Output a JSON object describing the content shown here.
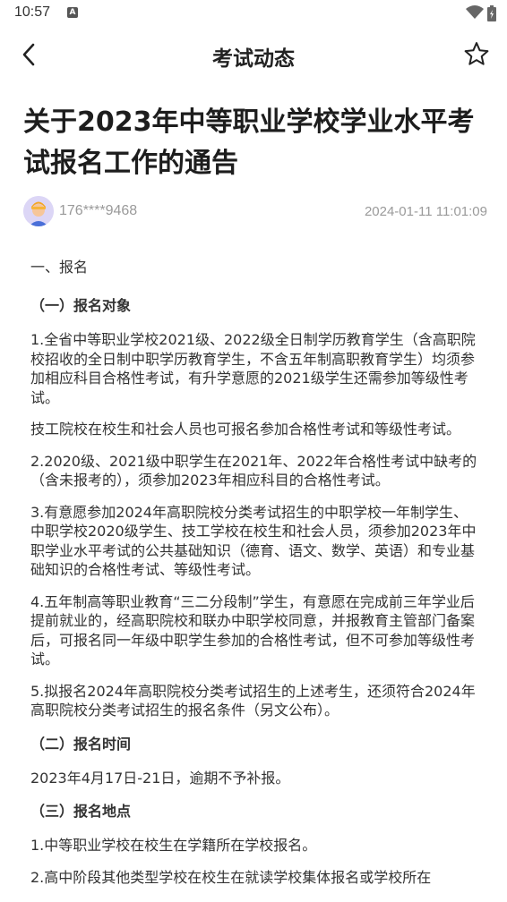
{
  "status_bar": {
    "time": "10:57",
    "a_label": "A"
  },
  "nav": {
    "title": "考试动态"
  },
  "article": {
    "title": "关于2023年中等职业学校学业水平考试报名工作的通告",
    "author": "176****9468",
    "date": "2024-01-11 11:01:09",
    "paragraphs": [
      "一、报名",
      "（一）报名对象",
      "1.全省中等职业学校2021级、2022级全日制学历教育学生（含高职院校招收的全日制中职学历教育学生，不含五年制高职教育学生）均须参加相应科目合格性考试，有升学意愿的2021级学生还需参加等级性考试。",
      "技工院校在校生和社会人员也可报名参加合格性考试和等级性考试。",
      "2.2020级、2021级中职学生在2021年、2022年合格性考试中缺考的（含未报考的），须参加2023年相应科目的合格性考试。",
      "3.有意愿参加2024年高职院校分类考试招生的中职学校一年制学生、中职学校2020级学生、技工学校在校生和社会人员，须参加2023年中职学业水平考试的公共基础知识（德育、语文、数学、英语）和专业基础知识的合格性考试、等级性考试。",
      "4.五年制高等职业教育“三二分段制”学生，有意愿在完成前三年学业后提前就业的，经高职院校和联办中职学校同意，并报教育主管部门备案后，可报名同一年级中职学生参加的合格性考试，但不可参加等级性考试。",
      "5.拟报名2024年高职院校分类考试招生的上述考生，还须符合2024年高职院校分类考试招生的报名条件（另文公布）。",
      "（二）报名时间",
      "2023年4月17日-21日，逾期不予补报。",
      "（三）报名地点",
      "1.中等职业学校在校生在学籍所在学校报名。",
      "2.高中阶段其他类型学校在校生在就读学校集体报名或学校所在"
    ]
  }
}
